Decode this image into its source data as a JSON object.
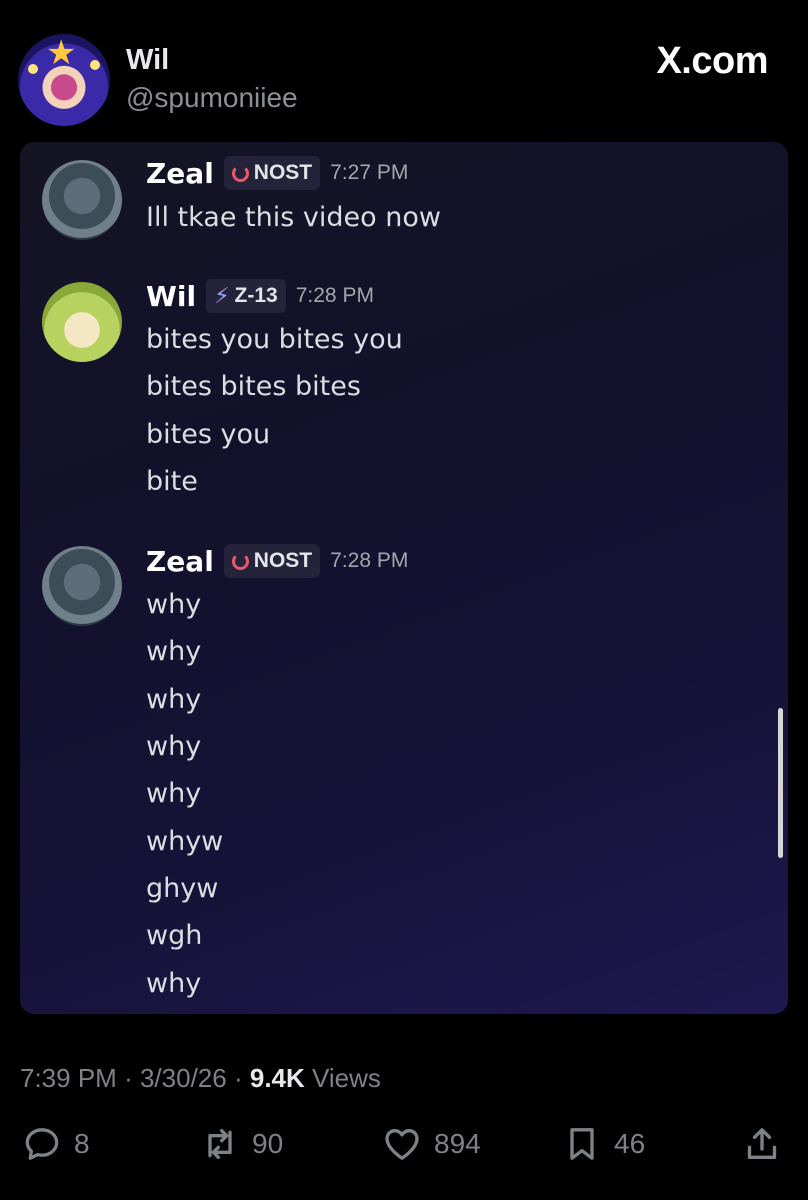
{
  "tweet": {
    "display_name": "Wil",
    "handle": "@spumoniiee",
    "brand": "X.com",
    "time": "7:39 PM",
    "date": "3/30/26",
    "views_count": "9.4K",
    "views_label": "Views",
    "separator": "·"
  },
  "actions": {
    "replies": "8",
    "reposts": "90",
    "likes": "894",
    "bookmarks": "46"
  },
  "chat": {
    "messages": [
      {
        "author": "Zeal",
        "tag": "NOST",
        "tag_icon": "ring-icon",
        "timestamp": "7:27 PM",
        "lines": [
          "Ill tkae this video now"
        ]
      },
      {
        "author": "Wil",
        "tag": "Z-13",
        "tag_icon": "bolt-icon",
        "timestamp": "7:28 PM",
        "lines": [
          "bites you bites you",
          "bites bites bites",
          "bites you",
          "bite"
        ]
      },
      {
        "author": "Zeal",
        "tag": "NOST",
        "tag_icon": "ring-icon",
        "timestamp": "7:28 PM",
        "lines": [
          "why",
          "why",
          "why",
          "why",
          "why",
          "whyw",
          "ghyw",
          "wgh",
          "why"
        ]
      }
    ]
  },
  "colors": {
    "background": "#000000",
    "embed_bg": "#151330",
    "muted": "#7d8287",
    "tag_ring": "#e8596a"
  }
}
